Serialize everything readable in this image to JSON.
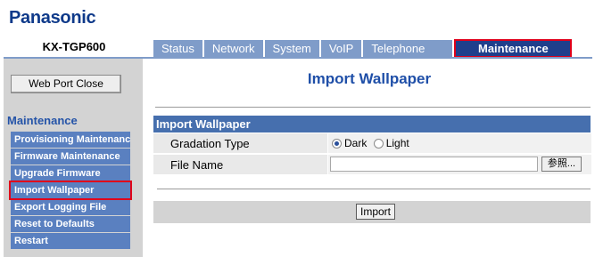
{
  "brand": {
    "logo": "Panasonic",
    "model": "KX-TGP600"
  },
  "tabs": [
    {
      "label": "Status"
    },
    {
      "label": "Network"
    },
    {
      "label": "System"
    },
    {
      "label": "VoIP"
    },
    {
      "label": "Telephone"
    },
    {
      "label": "Maintenance"
    }
  ],
  "sidebar": {
    "close_button": "Web Port Close",
    "heading": "Maintenance",
    "items": [
      {
        "label": "Provisioning Maintenance"
      },
      {
        "label": "Firmware Maintenance"
      },
      {
        "label": "Upgrade Firmware"
      },
      {
        "label": "Import Wallpaper"
      },
      {
        "label": "Export Logging File"
      },
      {
        "label": "Reset to Defaults"
      },
      {
        "label": "Restart"
      }
    ]
  },
  "main": {
    "title": "Import Wallpaper",
    "section_title": "Import Wallpaper",
    "gradation": {
      "label": "Gradation Type",
      "options": [
        "Dark",
        "Light"
      ],
      "selected": "Dark"
    },
    "file": {
      "label": "File Name",
      "value": "",
      "browse_label": "参照..."
    },
    "import_button": "Import"
  },
  "colors": {
    "accent": "#1f3f8c",
    "tab": "#7f9cc9",
    "sidebar_item": "#5a80c0",
    "highlight": "#e0001a"
  }
}
